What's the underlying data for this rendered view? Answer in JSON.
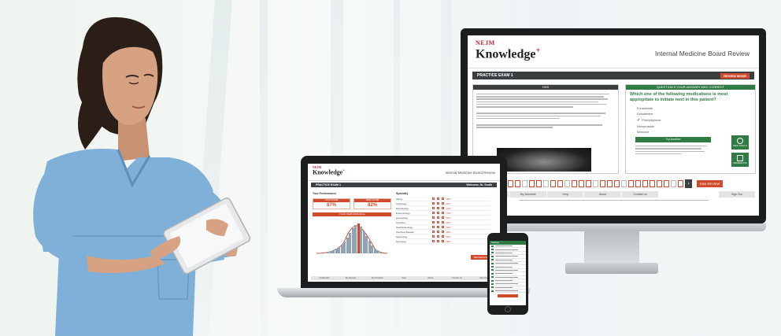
{
  "monitor": {
    "logo_brand": "NEJM",
    "logo_product": "Knowledge",
    "logo_mark": "+",
    "app_title": "Internal Medicine Board Review",
    "exam_bar_title": "PRACTICE EXAM 1",
    "exam_bar_button": "REVIEW MODE",
    "left_panel_header": "HHS",
    "right_panel_header": "QUESTION 5  YOUR ANSWER WAS CORRECT",
    "question": "Which one of the following medications is most appropriate to initiate next in this patient?",
    "options": [
      "Furosemide",
      "Dobutamine",
      "Phenylephrine",
      "Nitroprusside",
      "Milrinone"
    ],
    "try_button": "Try Another",
    "side_buttons": [
      "NEW SKILLS",
      "REMEDIATE"
    ],
    "pager_end_button": "END REVIEW",
    "footer_nav": [
      "My Reports",
      "My Schedule",
      "Help",
      "About",
      "Contact Us",
      "Sign Out"
    ]
  },
  "laptop": {
    "logo_brand": "NEJM",
    "logo_product": "Knowledge",
    "app_title": "Internal Medicine Board Review",
    "exam_bar_title": "PRACTICE EXAM 1",
    "exam_bar_user": "Welcome, Dr. Smith",
    "perf_label": "Your Performance",
    "scores": [
      {
        "title": "YOUR SCORE",
        "value": "87%"
      },
      {
        "title": "PEER SCORE",
        "value": "82%"
      }
    ],
    "perf_banner": "YOUR PERFORMANCE",
    "specialty_label": "Specialty",
    "specialties": [
      {
        "name": "Allergy",
        "pct": "88%"
      },
      {
        "name": "Cardiology",
        "pct": "82%"
      },
      {
        "name": "Dermatology",
        "pct": "91%"
      },
      {
        "name": "Endocrinology",
        "pct": "79%"
      },
      {
        "name": "Hematology",
        "pct": "85%"
      },
      {
        "name": "Geriatrics",
        "pct": "90%"
      },
      {
        "name": "Gastroenterology",
        "pct": "84%"
      },
      {
        "name": "Infectious Disease",
        "pct": "86%"
      },
      {
        "name": "Nephrology",
        "pct": "80%"
      },
      {
        "name": "Neurology",
        "pct": "88%"
      }
    ],
    "review_button": "REVIEW EXAM",
    "footer_nav": [
      "Dashboard",
      "My Reports",
      "My Schedule",
      "Help",
      "About",
      "Contact Us",
      "Sign Out"
    ]
  },
  "phone": {
    "bar_title": "Settings"
  },
  "colors": {
    "brand_red": "#c8262e",
    "accent_orange": "#d24a2c",
    "accent_green": "#2f7b43",
    "dark_bar": "#3c3f42",
    "scrubs_blue": "#7fb0d8"
  }
}
